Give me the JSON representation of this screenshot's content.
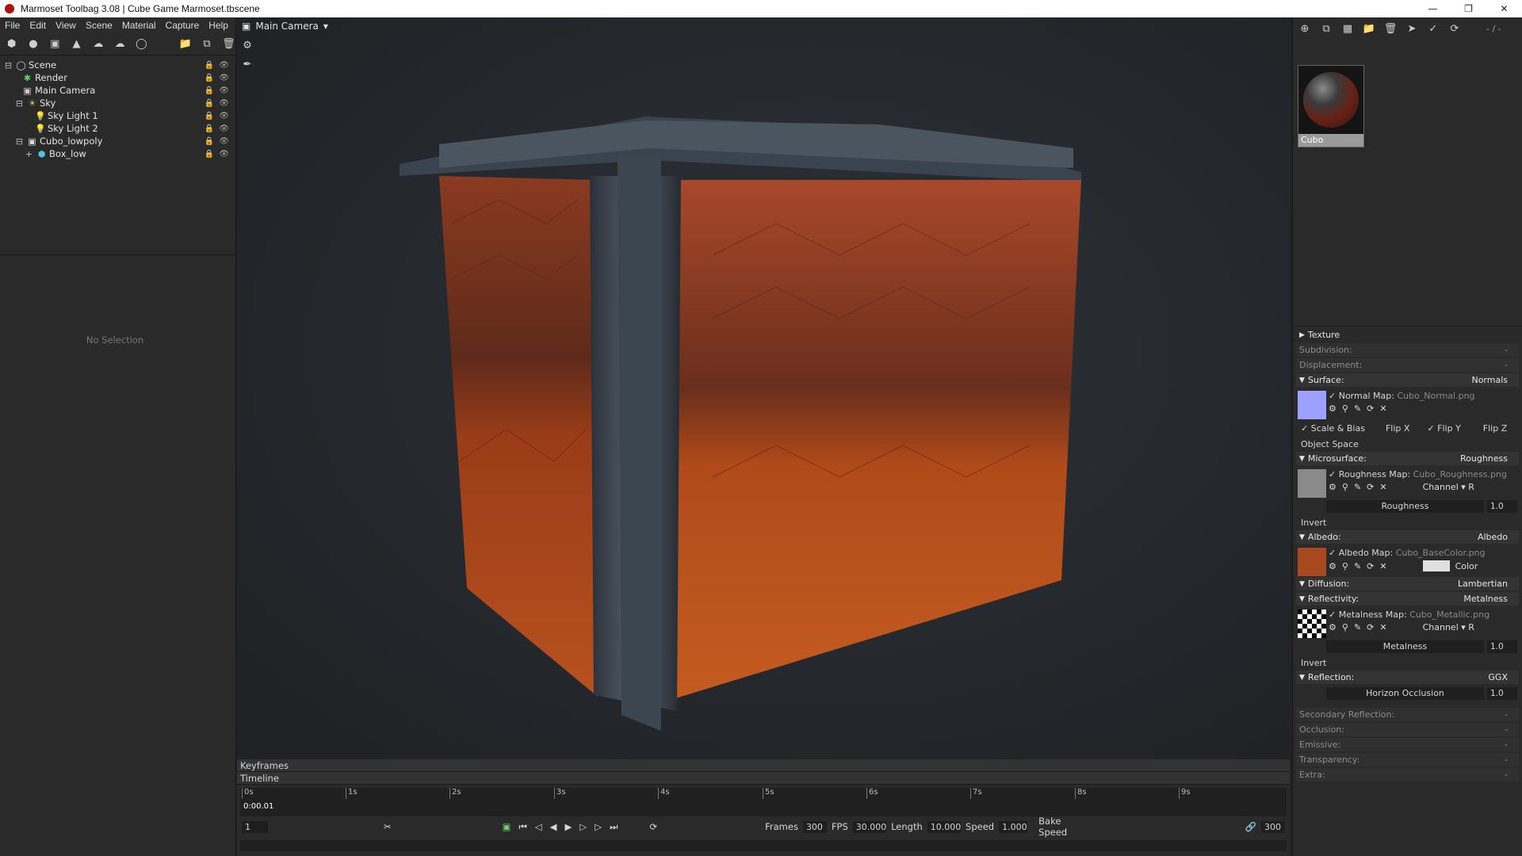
{
  "window": {
    "title": "Marmoset Toolbag 3.08  |  Cube Game Marmoset.tbscene"
  },
  "menu": [
    "File",
    "Edit",
    "View",
    "Scene",
    "Material",
    "Capture",
    "Help"
  ],
  "scene_tree": {
    "items": [
      "Scene",
      "Render",
      "Main Camera",
      "Sky",
      "Sky Light 1",
      "Sky Light 2",
      "Cubo_lowpoly",
      "Box_low"
    ]
  },
  "selection_panel": {
    "empty_text": "No Selection"
  },
  "viewport": {
    "camera_label": "Main Camera"
  },
  "material": {
    "name": "Cubo",
    "counter": "- / -",
    "sections": {
      "texture": "Texture",
      "subdivision": "Subdivision:",
      "displacement": "Displacement:",
      "surface": "Surface:",
      "surface_val": "Normals",
      "normal_map_label": "Normal Map:",
      "normal_map_file": "Cubo_Normal.png",
      "scale_bias": "Scale & Bias",
      "flip_x": "Flip X",
      "flip_y": "Flip Y",
      "flip_z": "Flip Z",
      "object_space": "Object Space",
      "microsurface": "Microsurface:",
      "microsurface_val": "Roughness",
      "roughness_map_label": "Roughness Map:",
      "roughness_map_file": "Cubo_Roughness.png",
      "channel": "Channel",
      "channel_val": "R",
      "roughness_slider": "Roughness",
      "roughness_val": "1.0",
      "invert": "Invert",
      "albedo": "Albedo:",
      "albedo_val": "Albedo",
      "albedo_map_label": "Albedo Map:",
      "albedo_map_file": "Cubo_BaseColor.png",
      "color": "Color",
      "diffusion": "Diffusion:",
      "diffusion_val": "Lambertian",
      "reflectivity": "Reflectivity:",
      "reflectivity_val": "Metalness",
      "metalness_map_label": "Metalness Map:",
      "metalness_map_file": "Cubo_Metallic.png",
      "metalness_slider": "Metalness",
      "metalness_val": "1.0",
      "reflection": "Reflection:",
      "reflection_val": "GGX",
      "horizon_occlusion": "Horizon Occlusion",
      "horizon_val": "1.0",
      "secondary_reflection": "Secondary Reflection:",
      "occlusion": "Occlusion:",
      "emissive": "Emissive:",
      "transparency": "Transparency:",
      "extra": "Extra:",
      "dash": "-"
    }
  },
  "timeline": {
    "keyframes_label": "Keyframes",
    "timeline_label": "Timeline",
    "current_time": "0:00.01",
    "ticks": [
      "0s",
      "1s",
      "2s",
      "3s",
      "4s",
      "5s",
      "6s",
      "7s",
      "8s",
      "9s"
    ],
    "frame_field": "1",
    "frames_label": "Frames",
    "frames_val": "300",
    "fps_label": "FPS",
    "fps_val": "30.000",
    "length_label": "Length",
    "length_val": "10.000",
    "speed_label": "Speed",
    "speed_val": "1.000",
    "bake_speed": "Bake Speed",
    "end_frame": "300"
  }
}
